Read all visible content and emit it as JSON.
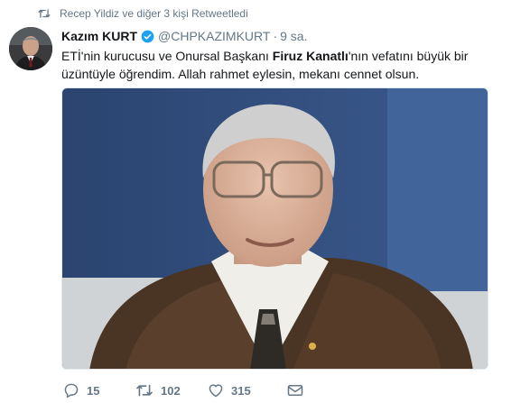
{
  "retweet_context": {
    "text": "Recep Yildiz ve diğer 3 kişi Retweetledi"
  },
  "tweet": {
    "author_name": "Kazım KURT",
    "handle": "@CHPKAZIMKURT",
    "separator": "·",
    "time": "9 sa.",
    "text_part1": "ETİ'nin kurucusu ve Onursal Başkanı ",
    "text_bold": "Firuz Kanatlı",
    "text_part2": "'nın vefatını büyük bir üzüntüyle öğrendim. Allah rahmet eylesin, mekanı cennet olsun."
  },
  "actions": {
    "reply_count": "15",
    "retweet_count": "102",
    "like_count": "315"
  },
  "icons": {
    "retweet": "retweet-icon",
    "verified": "verified-badge-icon",
    "reply": "reply-icon",
    "like": "heart-icon",
    "message": "envelope-icon"
  },
  "colors": {
    "verified": "#1da1f2",
    "secondary_text": "#657786"
  }
}
